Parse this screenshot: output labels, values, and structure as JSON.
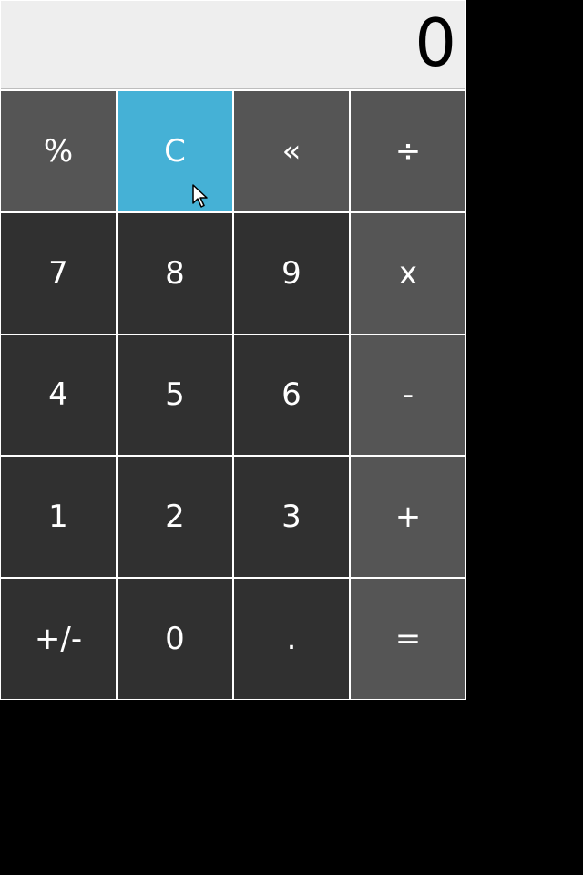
{
  "display": {
    "value": "0"
  },
  "keys": {
    "percent": "%",
    "clear": "C",
    "backspace": "«",
    "divide": "÷",
    "seven": "7",
    "eight": "8",
    "nine": "9",
    "multiply": "x",
    "four": "4",
    "five": "5",
    "six": "6",
    "subtract": "-",
    "one": "1",
    "two": "2",
    "three": "3",
    "add": "+",
    "sign": "+/-",
    "zero": "0",
    "decimal": ".",
    "equals": "="
  },
  "colors": {
    "background": "#000000",
    "display_bg": "#eeeeee",
    "digit_key": "#303030",
    "operator_key": "#555555",
    "active_key": "#45b1d6",
    "key_text": "#ffffff"
  },
  "cursor": {
    "icon": "mouse-pointer-icon"
  }
}
